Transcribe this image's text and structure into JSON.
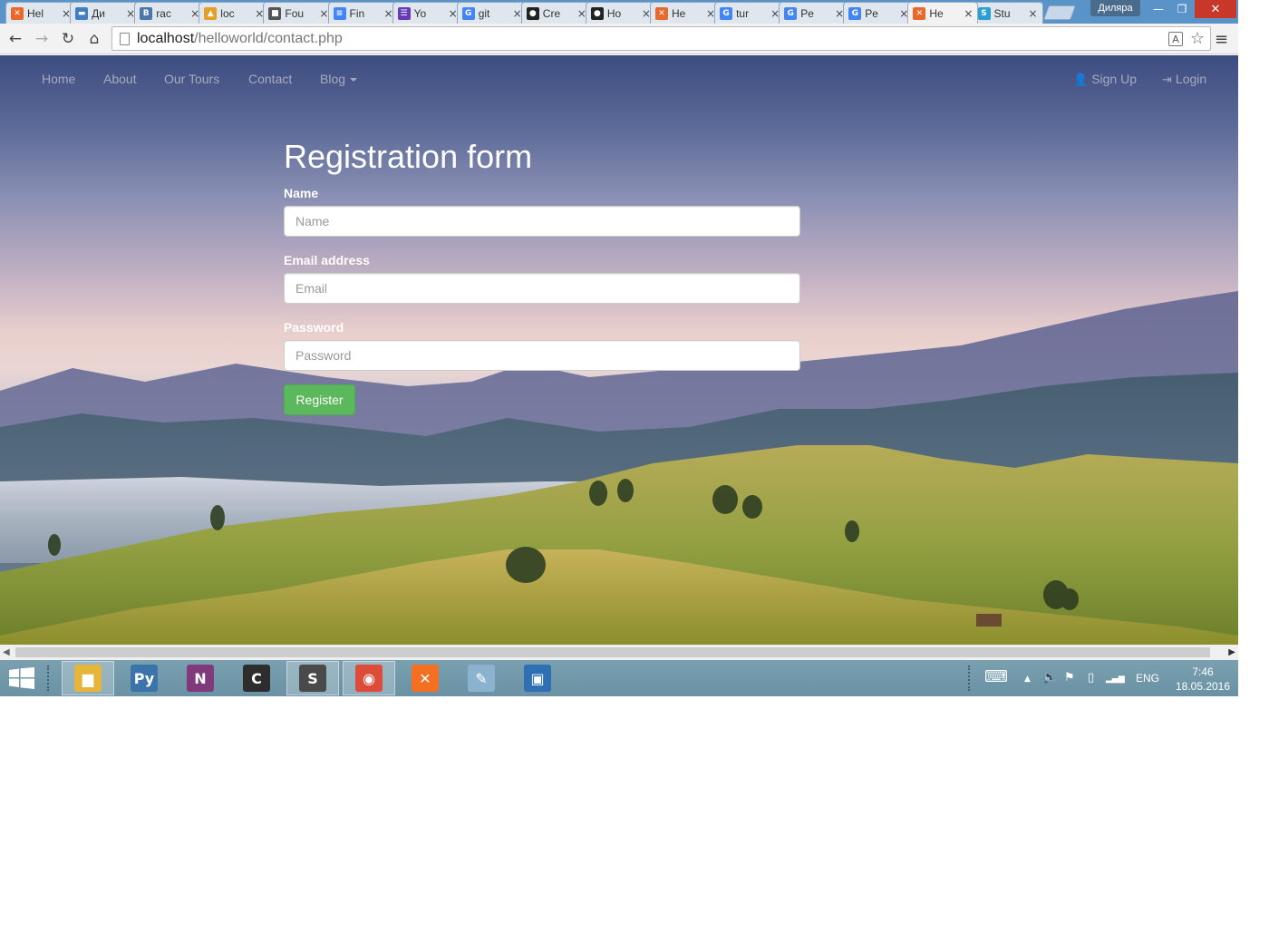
{
  "browser": {
    "tabs": [
      {
        "title": "Hel",
        "icon": "xampp-icon",
        "color": "#e8692b",
        "glyph": "✕"
      },
      {
        "title": "Ди",
        "icon": "chat-icon",
        "color": "#3f7fc3",
        "glyph": "▬"
      },
      {
        "title": "rac",
        "icon": "vk-icon",
        "color": "#4a76a8",
        "glyph": "B"
      },
      {
        "title": "loc",
        "icon": "phpmyadmin-icon",
        "color": "#e3a025",
        "glyph": "▲"
      },
      {
        "title": "Fou",
        "icon": "contact-card-icon",
        "color": "#555555",
        "glyph": "■"
      },
      {
        "title": "Fin",
        "icon": "google-docs-icon",
        "color": "#4285f4",
        "glyph": "≡"
      },
      {
        "title": "Yo",
        "icon": "google-forms-icon",
        "color": "#673ab7",
        "glyph": "☰"
      },
      {
        "title": "git",
        "icon": "google-icon",
        "color": "#4285f4",
        "glyph": "G"
      },
      {
        "title": "Cre",
        "icon": "github-icon",
        "color": "#222222",
        "glyph": "●"
      },
      {
        "title": "Ho",
        "icon": "github-icon",
        "color": "#222222",
        "glyph": "●"
      },
      {
        "title": "He",
        "icon": "xampp-icon",
        "color": "#e8692b",
        "glyph": "✕"
      },
      {
        "title": "tur",
        "icon": "google-icon",
        "color": "#4285f4",
        "glyph": "G"
      },
      {
        "title": "Pe",
        "icon": "google-icon",
        "color": "#4285f4",
        "glyph": "G"
      },
      {
        "title": "Pe",
        "icon": "google-icon",
        "color": "#4285f4",
        "glyph": "G"
      },
      {
        "title": "He",
        "icon": "xampp-icon",
        "color": "#e8692b",
        "glyph": "✕",
        "active": true
      },
      {
        "title": "Stu",
        "icon": "stack-icon",
        "color": "#2a9fd6",
        "glyph": "S"
      }
    ],
    "tab_close_glyph": "×",
    "user_name": "Диляра",
    "window_controls": {
      "minimize": "—",
      "maximize": "❐",
      "close": "✕"
    },
    "toolbar": {
      "back": "←",
      "forward": "→",
      "reload": "↻",
      "home": "⌂",
      "menu": "≡",
      "star": "☆",
      "translate": "A"
    },
    "url": {
      "host": "localhost",
      "path": "/helloworld/contact.php"
    }
  },
  "page": {
    "nav": {
      "home": "Home",
      "about": "About",
      "tours": "Our Tours",
      "contact": "Contact",
      "blog": "Blog",
      "signup": "Sign Up",
      "login": "Login",
      "signup_icon": "👤",
      "login_icon": "⇥"
    },
    "form": {
      "title": "Registration form",
      "name_label": "Name",
      "name_placeholder": "Name",
      "email_label": "Email address",
      "email_placeholder": "Email",
      "password_label": "Password",
      "password_placeholder": "Password",
      "submit_label": "Register"
    },
    "colors": {
      "button": "#5cb85c",
      "text": "#ffffff"
    }
  },
  "scrollbar": {
    "left": "◀",
    "right": "▶"
  },
  "taskbar": {
    "apps": [
      {
        "name": "file-explorer-icon",
        "color": "#e6b53c",
        "glyph": "▆",
        "active": true
      },
      {
        "name": "python-icon",
        "color": "#3b74a8",
        "glyph": "Py"
      },
      {
        "name": "onenote-icon",
        "color": "#80397b",
        "glyph": "N"
      },
      {
        "name": "terminal-icon",
        "color": "#2d2d2d",
        "glyph": "C"
      },
      {
        "name": "sublime-text-icon",
        "color": "#4a4a4a",
        "glyph": "S",
        "active": true
      },
      {
        "name": "chrome-icon",
        "color": "#dd4b39",
        "glyph": "◉",
        "active": true
      },
      {
        "name": "xampp-icon",
        "color": "#f36f21",
        "glyph": "✕"
      },
      {
        "name": "paint-icon",
        "color": "#8bb3cf",
        "glyph": "✎"
      },
      {
        "name": "photo-viewer-icon",
        "color": "#2f6fb4",
        "glyph": "▣"
      }
    ],
    "tray": {
      "keyboard": "⌨",
      "chevron": "▲",
      "volume": "🔈",
      "flag": "⚑",
      "battery": "▯",
      "signal": "▂▄▆",
      "lang": "ENG"
    },
    "clock": {
      "time": "7:46",
      "date": "18.05.2016"
    }
  }
}
